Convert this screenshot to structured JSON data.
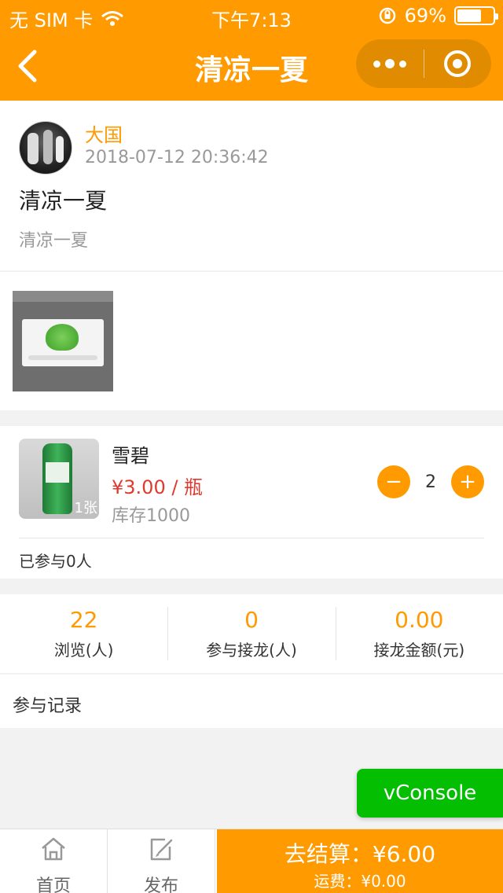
{
  "status_bar": {
    "carrier": "无 SIM 卡",
    "time": "下午7:13",
    "battery_percent": "69%",
    "battery_level": 0.69
  },
  "nav": {
    "title": "清凉一夏",
    "back_icon": "chevron-left-icon",
    "more_icon": "more-dots-icon",
    "close_icon": "target-ring-icon"
  },
  "post": {
    "author": "大国",
    "datetime": "2018-07-12 20:36:42",
    "title": "清凉一夏",
    "description": "清凉一夏"
  },
  "product": {
    "name": "雪碧",
    "price": "¥3.00 / 瓶",
    "stock": "库存1000",
    "image_count": "1张",
    "quantity": "2",
    "minus_label": "−",
    "plus_label": "+",
    "participants": "已参与0人"
  },
  "stats": [
    {
      "value": "22",
      "label": "浏览(人)"
    },
    {
      "value": "0",
      "label": "参与接龙(人)"
    },
    {
      "value": "0.00",
      "label": "接龙金额(元)"
    }
  ],
  "records": {
    "label": "参与记录"
  },
  "vconsole": {
    "label": "vConsole"
  },
  "bottom": {
    "tabs": [
      {
        "label": "首页",
        "icon": "home-icon"
      },
      {
        "label": "发布",
        "icon": "edit-icon"
      }
    ],
    "checkout_label": "去结算：¥6.00",
    "shipping_label": "运费：¥0.00"
  },
  "colors": {
    "accent": "#ff9a00",
    "price_red": "#e03a2f",
    "vconsole_green": "#04be02"
  }
}
